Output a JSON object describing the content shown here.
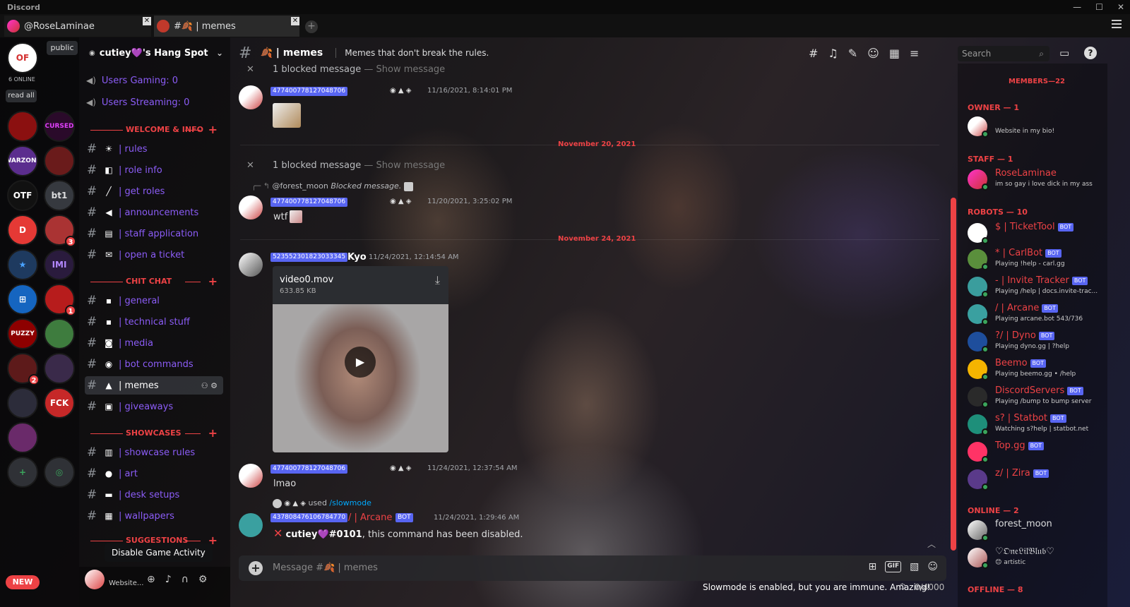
{
  "app": {
    "title": "Discord"
  },
  "tabs": [
    {
      "label": "@RoseLaminae"
    },
    {
      "label": "#🍂 | memes"
    }
  ],
  "server_rail": {
    "online_count": "6 ONLINE",
    "read_all": "read all",
    "public_chip": "public",
    "new_pill": "NEW",
    "servers": [
      {
        "label": "OF",
        "bg": "#ffffff",
        "fg": "#d32f2f",
        "badge": ""
      },
      {
        "label": "",
        "bg": "#8b1010",
        "fg": "#fff",
        "badge": ""
      },
      {
        "label": "CURSED",
        "bg": "#2a0a2a",
        "fg": "#e040fb",
        "badge": ""
      },
      {
        "label": "WARZONE",
        "bg": "#5b2d8e",
        "fg": "#fff",
        "badge": ""
      },
      {
        "label": "",
        "bg": "#6a1b1b",
        "fg": "#fff",
        "badge": ""
      },
      {
        "label": "OTF",
        "bg": "#111111",
        "fg": "#fff",
        "badge": ""
      },
      {
        "label": "bt1",
        "bg": "#36393f",
        "fg": "#dcddde",
        "badge": ""
      },
      {
        "label": "D",
        "bg": "#e53935",
        "fg": "#fff",
        "badge": ""
      },
      {
        "label": "",
        "bg": "#a33",
        "fg": "#fff",
        "badge": "3"
      },
      {
        "label": "★",
        "bg": "#1e3a5f",
        "fg": "#4aa3ff",
        "badge": ""
      },
      {
        "label": "ΙΜΙ",
        "bg": "#2a1b3d",
        "fg": "#b388ff",
        "badge": ""
      },
      {
        "label": "⊞",
        "bg": "#1565c0",
        "fg": "#fff",
        "badge": ""
      },
      {
        "label": "",
        "bg": "#b71c1c",
        "fg": "#fff",
        "badge": "1"
      },
      {
        "label": "PUZZY",
        "bg": "#8e0000",
        "fg": "#fff",
        "badge": ""
      },
      {
        "label": "",
        "bg": "#3e7c3e",
        "fg": "#fff",
        "badge": ""
      },
      {
        "label": "",
        "bg": "#5d1a1a",
        "fg": "#ffd54f",
        "badge": "2"
      },
      {
        "label": "",
        "bg": "#3a2a4a",
        "fg": "#fff",
        "badge": ""
      },
      {
        "label": "",
        "bg": "#2c2c3a",
        "fg": "#fff",
        "badge": ""
      },
      {
        "label": "FCK",
        "bg": "#c62828",
        "fg": "#fff",
        "badge": ""
      },
      {
        "label": "",
        "bg": "#6a2a6a",
        "fg": "#fff",
        "badge": ""
      },
      {
        "label": "+",
        "bg": "#2f3136",
        "fg": "#3ba55c",
        "badge": ""
      },
      {
        "label": "◎",
        "bg": "#2f3136",
        "fg": "#3ba55c",
        "badge": ""
      }
    ]
  },
  "sidebar": {
    "server_name": "cutiey💜's Hang Spot",
    "voice": [
      {
        "label": "Users Gaming: 0"
      },
      {
        "label": "Users Streaming: 0"
      }
    ],
    "categories": [
      {
        "label": "WELCOME & INFO"
      },
      {
        "label": "CHIT CHAT"
      },
      {
        "label": "SHOWCASES"
      },
      {
        "label": "SUGGESTIONS"
      }
    ],
    "channels": [
      {
        "emoji": "☀",
        "name": "| rules"
      },
      {
        "emoji": "◧",
        "name": "| role info"
      },
      {
        "emoji": "╱",
        "name": "| get roles"
      },
      {
        "emoji": "◀",
        "name": "| announcements"
      },
      {
        "emoji": "▤",
        "name": "| staff application"
      },
      {
        "emoji": "✉",
        "name": "| open a ticket"
      },
      {
        "emoji": "▪",
        "name": "| general"
      },
      {
        "emoji": "▪",
        "name": "| technical stuff"
      },
      {
        "emoji": "◙",
        "name": "| media"
      },
      {
        "emoji": "◉",
        "name": "| bot commands"
      },
      {
        "emoji": "▲",
        "name": "| memes"
      },
      {
        "emoji": "▣",
        "name": "| giveaways"
      },
      {
        "emoji": "▥",
        "name": "| showcase rules"
      },
      {
        "emoji": "●",
        "name": "| art"
      },
      {
        "emoji": "▬",
        "name": "| desk setups"
      },
      {
        "emoji": "▦",
        "name": "| wallpapers"
      }
    ],
    "tooltip": "Disable Game Activity",
    "user_status": "Website..."
  },
  "header": {
    "channel_name": "🍂 | memes",
    "topic": "Memes that don't break the rules.",
    "search_placeholder": "Search"
  },
  "messages": {
    "blocked_top": "1 blocked message",
    "blocked_mid": "1 blocked message",
    "show_message": "— Show message",
    "m1": {
      "tag": "477400778127048706",
      "time": "11/16/2021, 8:14:01 PM"
    },
    "date1": "November 20, 2021",
    "reply": {
      "user": "@forest_moon",
      "text": "Blocked message."
    },
    "m2": {
      "tag": "477400778127048706",
      "time": "11/20/2021, 3:25:02 PM",
      "text": "wtf"
    },
    "date2": "November 24, 2021",
    "m3": {
      "tag": "523552301823033345",
      "name": "Kyo",
      "time": "11/24/2021, 12:14:54 AM"
    },
    "video": {
      "name": "video0.mov",
      "size": "633.85 KB"
    },
    "m4": {
      "tag": "477400778127048706",
      "time": "11/24/2021, 12:37:54 AM",
      "text": "lmao"
    },
    "used": {
      "text": "used",
      "command": "/slowmode"
    },
    "m5": {
      "tag": "437808476106784770",
      "name": "/ | Arcane",
      "bot": "BOT",
      "time": "11/24/2021, 1:29:46 AM",
      "user": "cutiey💜#0101",
      "text": ", this command has been disabled."
    }
  },
  "composer": {
    "placeholder": "Message #🍂 | memes",
    "slowmode": "Slowmode is enabled, but you are immune. Amazing!",
    "count": "0/4000"
  },
  "members": {
    "title": "MEMBERS—22",
    "groups": {
      "owner": "OWNER — 1",
      "staff": "STAFF — 1",
      "robots": "ROBOTS — 10",
      "online": "ONLINE — 2",
      "offline": "OFFLINE — 8"
    },
    "owner": {
      "name": "",
      "status": "Website in my bio!"
    },
    "staff": [
      {
        "name": "RoseLaminae",
        "status": "im so gay i love dick in my ass"
      }
    ],
    "robots": [
      {
        "name": "$ | TicketTool",
        "status": "",
        "color": "#ffffff"
      },
      {
        "name": "* | CarlBot",
        "status": "Playing !help - carl.gg",
        "color": "#5a8f3c"
      },
      {
        "name": "- | Invite Tracker",
        "status": "Playing /help | docs.invite-trac...",
        "color": "#3a9d9d"
      },
      {
        "name": "/ | Arcane",
        "status": "Playing arcane.bot 543/736",
        "color": "#3aa0a0"
      },
      {
        "name": "?/ | Dyno",
        "status": "Playing dyno.gg | ?help",
        "color": "#1e4e9c"
      },
      {
        "name": "Beemo",
        "status": "Playing beemo.gg • /help",
        "color": "#f4b400"
      },
      {
        "name": "DiscordServers",
        "status": "Playing /bump to bump server",
        "color": "#2a2a2a"
      },
      {
        "name": "s? | Statbot",
        "status": "Watching s?help | statbot.net",
        "color": "#1e8f7a"
      },
      {
        "name": "Top.gg",
        "status": "",
        "color": "#ff3366"
      },
      {
        "name": "z/ | Zira",
        "status": "",
        "color": "#5a3a8a"
      }
    ],
    "online": [
      {
        "name": "forest_moon",
        "status": ""
      },
      {
        "name": "♡𝔒𝔫𝔢𝔏𝔦𝔩𝔅𝔩𝔲𝔟♡",
        "status": "😊 artistic"
      }
    ],
    "bot_label": "BOT"
  }
}
